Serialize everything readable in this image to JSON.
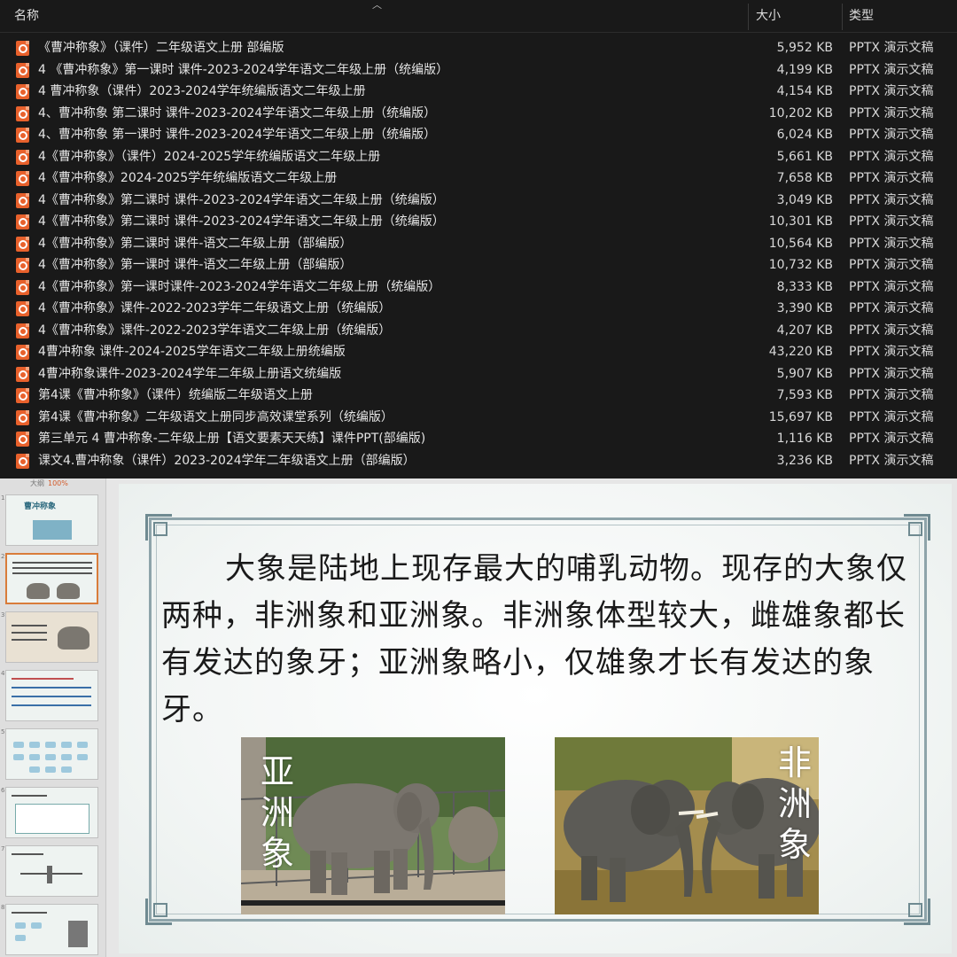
{
  "explorer": {
    "columns": {
      "name": "名称",
      "size": "大小",
      "type": "类型"
    },
    "files": [
      {
        "name": "《曹冲称象》（课件）二年级语文上册 部编版",
        "size": "5,952 KB",
        "type": "PPTX 演示文稿"
      },
      {
        "name": "4 《曹冲称象》第一课时 课件-2023-2024学年语文二年级上册（统编版）",
        "size": "4,199 KB",
        "type": "PPTX 演示文稿"
      },
      {
        "name": "4 曹冲称象（课件）2023-2024学年统编版语文二年级上册",
        "size": "4,154 KB",
        "type": "PPTX 演示文稿"
      },
      {
        "name": "4、曹冲称象 第二课时 课件-2023-2024学年语文二年级上册（统编版）",
        "size": "10,202 KB",
        "type": "PPTX 演示文稿"
      },
      {
        "name": "4、曹冲称象 第一课时 课件-2023-2024学年语文二年级上册（统编版）",
        "size": "6,024 KB",
        "type": "PPTX 演示文稿"
      },
      {
        "name": "4《曹冲称象》（课件）2024-2025学年统编版语文二年级上册",
        "size": "5,661 KB",
        "type": "PPTX 演示文稿"
      },
      {
        "name": "4《曹冲称象》2024-2025学年统编版语文二年级上册",
        "size": "7,658 KB",
        "type": "PPTX 演示文稿"
      },
      {
        "name": "4《曹冲称象》第二课时  课件-2023-2024学年语文二年级上册（统编版）",
        "size": "3,049 KB",
        "type": "PPTX 演示文稿"
      },
      {
        "name": "4《曹冲称象》第二课时 课件-2023-2024学年语文二年级上册（统编版）",
        "size": "10,301 KB",
        "type": "PPTX 演示文稿"
      },
      {
        "name": "4《曹冲称象》第二课时 课件-语文二年级上册（部编版）",
        "size": "10,564 KB",
        "type": "PPTX 演示文稿"
      },
      {
        "name": "4《曹冲称象》第一课时 课件-语文二年级上册（部编版）",
        "size": "10,732 KB",
        "type": "PPTX 演示文稿"
      },
      {
        "name": "4《曹冲称象》第一课时课件-2023-2024学年语文二年级上册（统编版）",
        "size": "8,333 KB",
        "type": "PPTX 演示文稿"
      },
      {
        "name": "4《曹冲称象》课件-2022-2023学年二年级语文上册（统编版）",
        "size": "3,390 KB",
        "type": "PPTX 演示文稿"
      },
      {
        "name": "4《曹冲称象》课件-2022-2023学年语文二年级上册（统编版）",
        "size": "4,207 KB",
        "type": "PPTX 演示文稿"
      },
      {
        "name": "4曹冲称象 课件-2024-2025学年语文二年级上册统编版",
        "size": "43,220 KB",
        "type": "PPTX 演示文稿"
      },
      {
        "name": "4曹冲称象课件-2023-2024学年二年级上册语文统编版",
        "size": "5,907 KB",
        "type": "PPTX 演示文稿"
      },
      {
        "name": "第4课《曹冲称象》（课件）统编版二年级语文上册",
        "size": "7,593 KB",
        "type": "PPTX 演示文稿"
      },
      {
        "name": "第4课《曹冲称象》二年级语文上册同步高效课堂系列（统编版）",
        "size": "15,697 KB",
        "type": "PPTX 演示文稿"
      },
      {
        "name": "第三单元 4 曹冲称象-二年级上册【语文要素天天练】课件PPT(部编版)",
        "size": "1,116 KB",
        "type": "PPTX 演示文稿"
      },
      {
        "name": "课文4.曹冲称象（课件）2023-2024学年二年级语文上册（部编版）",
        "size": "3,236 KB",
        "type": "PPTX 演示文稿"
      }
    ]
  },
  "ppt": {
    "panel": {
      "label": "大纲",
      "zoom": "100%"
    },
    "thumbnails": [
      {
        "num": "1",
        "title": "曹冲称象"
      },
      {
        "num": "2",
        "title": ""
      },
      {
        "num": "3",
        "title": ""
      },
      {
        "num": "4",
        "title": ""
      },
      {
        "num": "5",
        "title": ""
      },
      {
        "num": "6",
        "title": ""
      },
      {
        "num": "7",
        "title": ""
      },
      {
        "num": "8",
        "title": ""
      }
    ],
    "slide": {
      "paragraph": "大象是陆地上现存最大的哺乳动物。现存的大象仅两种，非洲象和亚洲象。非洲象体型较大，雌雄象都长有发达的象牙；亚洲象略小，仅雄象才长有发达的象牙。",
      "asian_label": "亚洲象",
      "african_label": "非洲象"
    }
  }
}
